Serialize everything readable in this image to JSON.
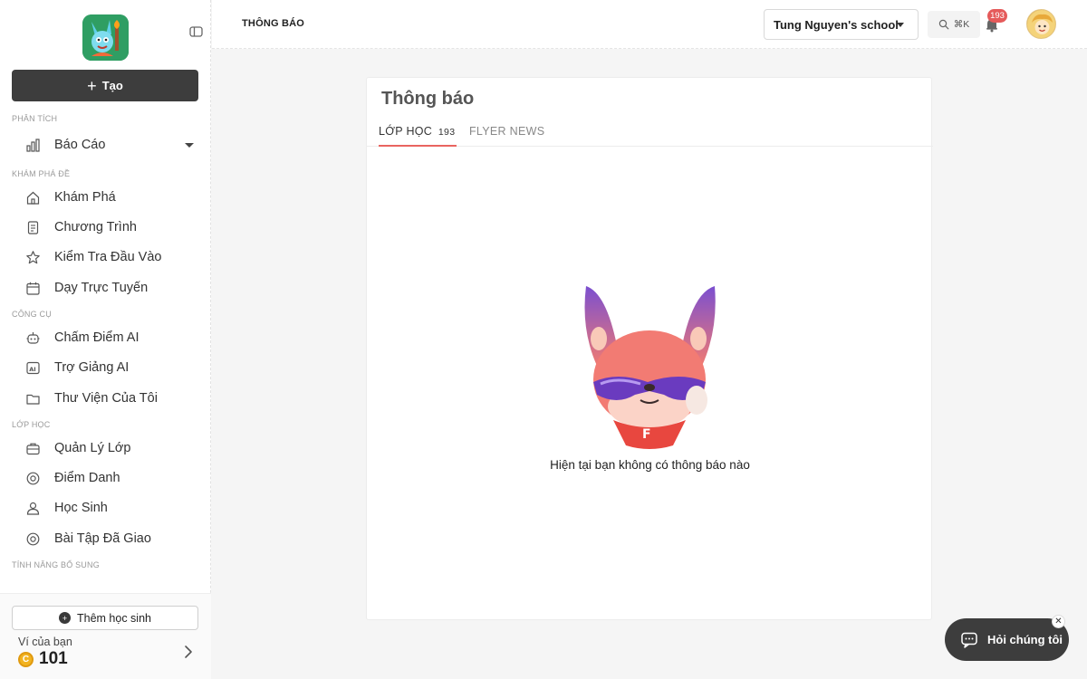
{
  "header": {
    "page_label": "THÔNG BÁO",
    "school": "Tung Nguyen's school",
    "search_shortcut": "⌘K",
    "notification_count": "193"
  },
  "sidebar": {
    "create_label": "Tạo",
    "sections": [
      {
        "title": "PHÂN TÍCH",
        "items": [
          {
            "label": "Báo Cáo",
            "icon": "bar-chart-icon",
            "has_dropdown": true
          }
        ]
      },
      {
        "title": "KHÁM PHÁ ĐỀ",
        "items": [
          {
            "label": "Khám Phá",
            "icon": "home-icon"
          },
          {
            "label": "Chương Trình",
            "icon": "document-icon"
          },
          {
            "label": "Kiểm Tra Đầu Vào",
            "icon": "star-icon"
          },
          {
            "label": "Dạy Trực Tuyến",
            "icon": "calendar-icon"
          }
        ]
      },
      {
        "title": "CÔNG CỤ",
        "items": [
          {
            "label": "Chấm Điểm AI",
            "icon": "robot-icon"
          },
          {
            "label": "Trợ Giảng AI",
            "icon": "ai-icon"
          },
          {
            "label": "Thư Viện Của Tôi",
            "icon": "folder-icon"
          }
        ]
      },
      {
        "title": "LỚP HỌC",
        "items": [
          {
            "label": "Quản Lý Lớp",
            "icon": "briefcase-icon"
          },
          {
            "label": "Điểm Danh",
            "icon": "badge-icon"
          },
          {
            "label": "Học Sinh",
            "icon": "users-icon"
          },
          {
            "label": "Bài Tập Đã Giao",
            "icon": "assignment-icon"
          }
        ]
      },
      {
        "title": "TÍNH NĂNG BỔ SUNG",
        "items": []
      }
    ],
    "add_student_label": "Thêm học sinh",
    "wallet_label": "Ví của bạn",
    "wallet_value": "101",
    "coin_symbol": "C"
  },
  "card": {
    "title": "Thông báo",
    "tabs": [
      {
        "label": "LỚP HỌC",
        "count": "193",
        "active": true
      },
      {
        "label": "FLYER NEWS",
        "active": false
      }
    ],
    "empty_message": "Hiện tại bạn không có thông báo nào"
  },
  "chat": {
    "label": "Hỏi chúng tôi",
    "close_symbol": "✕"
  },
  "colors": {
    "sidebar_button": "#3d3d3d",
    "active_tab_underline": "#e9645f",
    "badge": "#e55a5a",
    "coin": "#f2b320"
  }
}
